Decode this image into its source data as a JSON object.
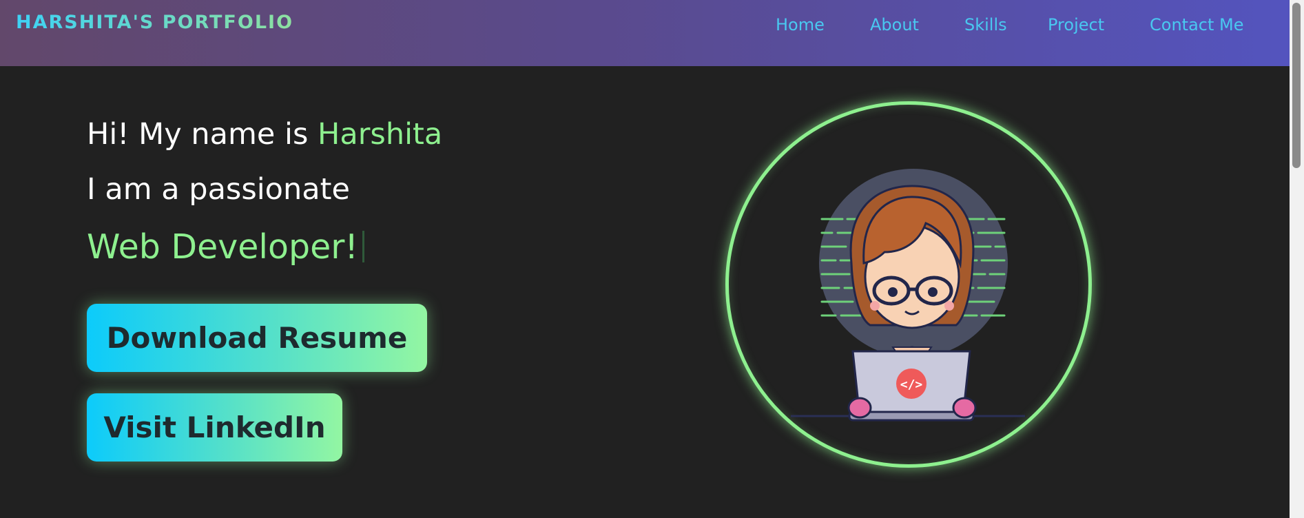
{
  "header": {
    "brand": "HARSHITA'S PORTFOLIO",
    "nav": [
      "Home",
      "About",
      "Skills",
      "Project",
      "Contact Me"
    ]
  },
  "hero": {
    "greeting_prefix": "Hi! My name is ",
    "name": "Harshita",
    "intro": "I am a passionate",
    "role": "Web Developer!",
    "buttons": {
      "resume": "Download Resume",
      "linkedin": "Visit LinkedIn"
    }
  },
  "avatar": {
    "icon": "girl-coding-laptop-illustration",
    "laptop_badge": "</>"
  },
  "colors": {
    "accent_green": "#8ef08f",
    "accent_cyan": "#0ccbfb",
    "background": "#212121"
  }
}
